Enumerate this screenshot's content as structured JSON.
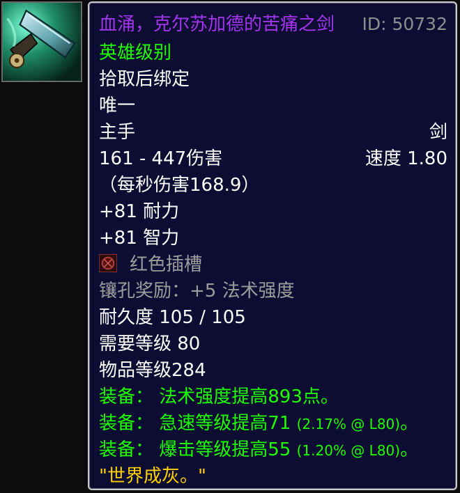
{
  "item": {
    "name": "血涌，克尔苏加德的苦痛之剑",
    "id_label": "ID: 50732",
    "difficulty": "英雄级别",
    "binding": "拾取后绑定",
    "unique": "唯一",
    "slot": "主手",
    "weapon_type": "剑",
    "damage": "161 - 447伤害",
    "speed": "速度 1.80",
    "dps": "（每秒伤害168.9）",
    "stats": [
      "+81 耐力",
      "+81 智力"
    ],
    "socket": "红色插槽",
    "socket_bonus": "镶孔奖励：+5 法术强度",
    "durability": "耐久度 105 / 105",
    "required_level": "需要等级 80",
    "item_level": "物品等级284",
    "equip_effects": [
      {
        "text": "装备： 法术强度提高893点。",
        "detail": ""
      },
      {
        "text": "装备： 急速等级提高71 ",
        "detail": "(2.17% @ L80)",
        "suffix": "。"
      },
      {
        "text": "装备： 爆击等级提高55 ",
        "detail": "(1.20% @ L80)",
        "suffix": "。"
      }
    ],
    "flavor_text": "\"世界成灰。\""
  },
  "icons": {
    "item_icon": "sword-item-icon",
    "socket_icon": "red-socket-icon"
  },
  "colors": {
    "epic": "#a335ee",
    "green": "#1eff00",
    "gray": "#9d9d9d",
    "gold": "#ffd100",
    "background": "#0d0d33"
  }
}
